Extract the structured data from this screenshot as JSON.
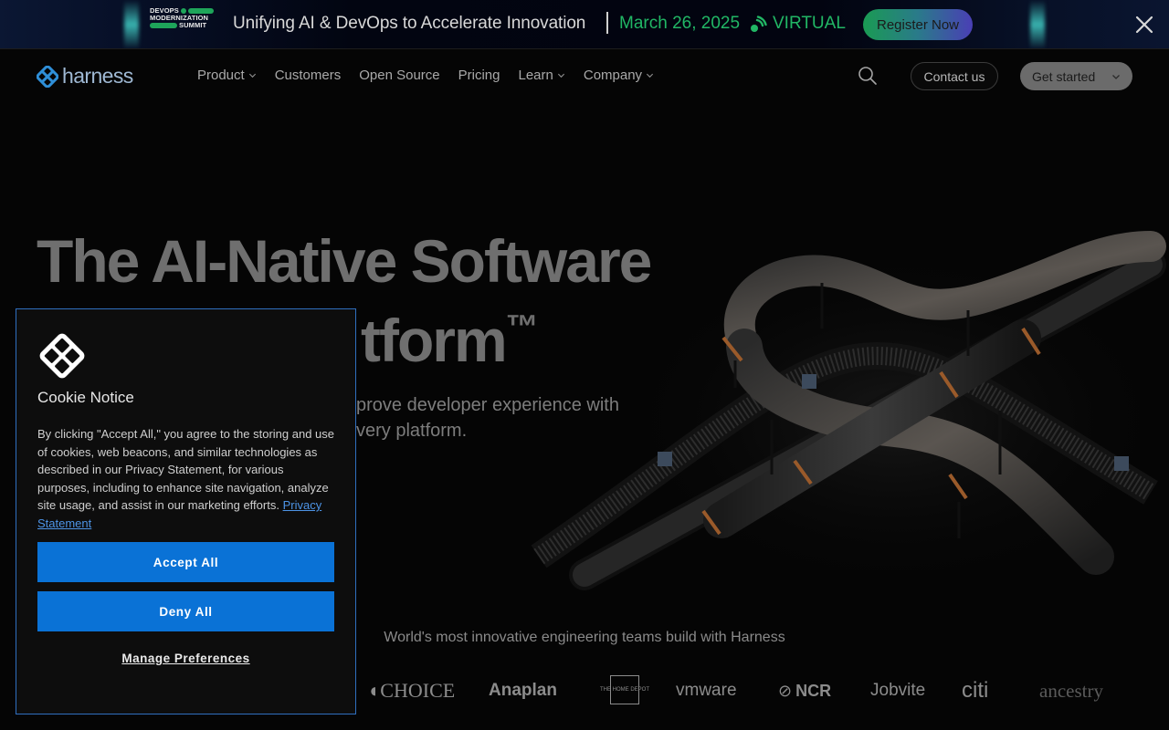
{
  "banner": {
    "logo_lines": [
      "DEVOPS",
      "MODERNIZATION",
      "SUMMIT"
    ],
    "headline": "Unifying AI & DevOps to Accelerate Innovation",
    "date": "March 26, 2025",
    "mode": "VIRTUAL",
    "register_label": "Register Now",
    "icons": {
      "virtual": "broadcast-icon",
      "close": "close-icon"
    }
  },
  "nav": {
    "brand": "harness",
    "items": [
      {
        "label": "Product",
        "has_dropdown": true
      },
      {
        "label": "Customers",
        "has_dropdown": false
      },
      {
        "label": "Open Source",
        "has_dropdown": false
      },
      {
        "label": "Pricing",
        "has_dropdown": false
      },
      {
        "label": "Learn",
        "has_dropdown": true
      },
      {
        "label": "Company",
        "has_dropdown": true
      }
    ],
    "contact_label": "Contact us",
    "get_started_label": "Get started",
    "icons": {
      "search": "search-icon",
      "chevron": "chevron-down-icon"
    }
  },
  "hero": {
    "title_line1": "The AI-Native Software",
    "title_line2_visible": "tform",
    "trademark": "™",
    "subtitle_line1": "prove developer experience with",
    "subtitle_line2": "very platform.",
    "trusted_text": "World's most innovative engineering teams build with Harness"
  },
  "customer_logos": [
    "CHOICE",
    "Anaplan",
    "THE HOME DEPOT",
    "vmware",
    "NCR",
    "Jobvite",
    "citi",
    "ancestry"
  ],
  "cookie": {
    "title": "Cookie Notice",
    "body": "By clicking \"Accept All,\" you agree to the storing and use of cookies, web beacons, and similar technologies as described in our Privacy Statement, for various purposes, including to enhance site navigation, analyze site usage, and assist in our marketing efforts.",
    "privacy_link": "Privacy Statement",
    "accept_label": "Accept All",
    "deny_label": "Deny All",
    "manage_label": "Manage Preferences"
  },
  "colors": {
    "accent_green": "#21b765",
    "cookie_button_blue": "#0a72d6",
    "brand_blue": "#2f8fd8",
    "page_background": "#050505"
  }
}
